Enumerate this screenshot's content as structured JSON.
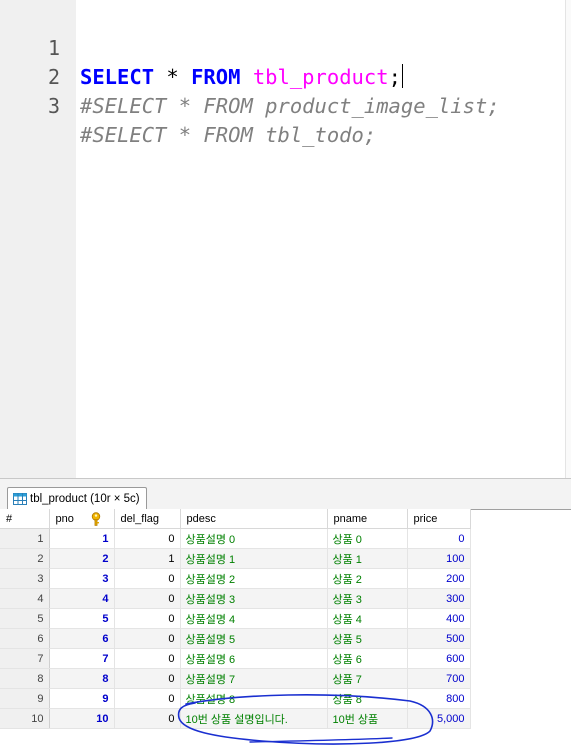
{
  "editor": {
    "lines": [
      {
        "number": "1",
        "parts": [
          "SELECT",
          " * ",
          "FROM",
          " ",
          "tbl_product",
          ";"
        ]
      },
      {
        "number": "2",
        "text": "#SELECT * FROM product_image_list;"
      },
      {
        "number": "3",
        "text": "#SELECT * FROM tbl_todo;"
      }
    ]
  },
  "result": {
    "tab_label": "tbl_product (10r × 5c)",
    "tab_icon": "grid-icon",
    "key_icon": "primary-key-icon",
    "columns": [
      "#",
      "pno",
      "del_flag",
      "pdesc",
      "pname",
      "price"
    ],
    "rows": [
      {
        "n": "1",
        "pno": "1",
        "del_flag": "0",
        "pdesc": "상품설명 0",
        "pname": "상품 0",
        "price": "0"
      },
      {
        "n": "2",
        "pno": "2",
        "del_flag": "1",
        "pdesc": "상품설명 1",
        "pname": "상품 1",
        "price": "100"
      },
      {
        "n": "3",
        "pno": "3",
        "del_flag": "0",
        "pdesc": "상품설명 2",
        "pname": "상품 2",
        "price": "200"
      },
      {
        "n": "4",
        "pno": "4",
        "del_flag": "0",
        "pdesc": "상품설명 3",
        "pname": "상품 3",
        "price": "300"
      },
      {
        "n": "5",
        "pno": "5",
        "del_flag": "0",
        "pdesc": "상품설명 4",
        "pname": "상품 4",
        "price": "400"
      },
      {
        "n": "6",
        "pno": "6",
        "del_flag": "0",
        "pdesc": "상품설명 5",
        "pname": "상품 5",
        "price": "500"
      },
      {
        "n": "7",
        "pno": "7",
        "del_flag": "0",
        "pdesc": "상품설명 6",
        "pname": "상품 6",
        "price": "600"
      },
      {
        "n": "8",
        "pno": "8",
        "del_flag": "0",
        "pdesc": "상품설명 7",
        "pname": "상품 7",
        "price": "700"
      },
      {
        "n": "9",
        "pno": "9",
        "del_flag": "0",
        "pdesc": "상품설명 8",
        "pname": "상품 8",
        "price": "800"
      },
      {
        "n": "10",
        "pno": "10",
        "del_flag": "0",
        "pdesc": "10번 상품 설명입니다.",
        "pname": "10번 상품",
        "price": "5,000"
      }
    ]
  },
  "colors": {
    "keyword": "#0000ff",
    "table_name": "#ff00ff",
    "comment": "#808080",
    "text_cell": "#008000",
    "number_cell": "#0000cc",
    "annotation_ink": "#1a2fd0"
  }
}
